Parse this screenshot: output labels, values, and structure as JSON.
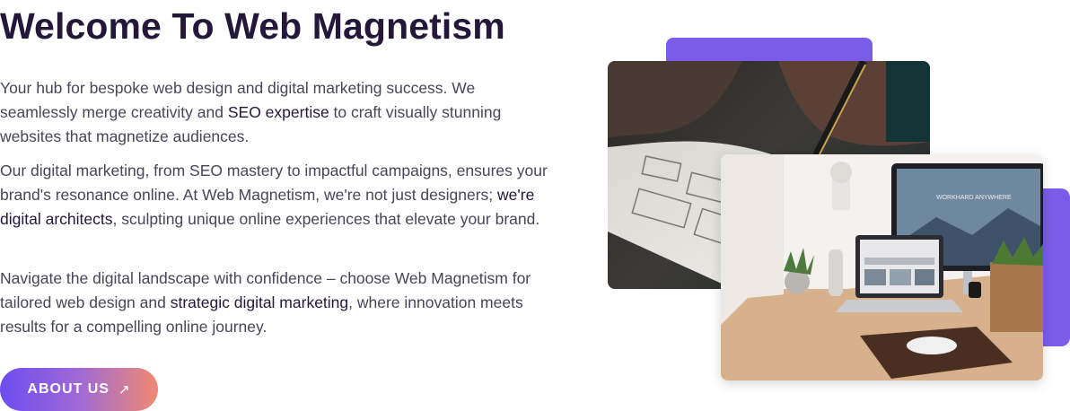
{
  "section": {
    "title": "Welcome To Web Magnetism",
    "paragraph1": {
      "part1": "Your hub for bespoke web design and digital marketing success. We seamlessly merge creativity and ",
      "bold": "SEO expertise",
      "part2": " to craft visually stunning websites that magnetize audiences."
    },
    "paragraph2": {
      "part1": "Our digital marketing, from SEO mastery to impactful campaigns, ensures your brand's resonance online. At Web Magnetism, we're not just designers; ",
      "bold": "we're digital architects",
      "part2": ", sculpting unique online experiences that elevate your brand."
    },
    "paragraph3": {
      "part1": "Navigate the digital landscape with confidence – choose Web Magnetism for tailored web design and ",
      "bold": "strategic digital marketing",
      "part2": ", where innovation meets results for a compelling online journey."
    },
    "about_button": {
      "label": "ABOUT US",
      "icon": "arrow-up-right-icon"
    }
  },
  "colors": {
    "title": "#24173a",
    "body_text": "#4a4458",
    "accent": "#7b5ce9",
    "button_gradient_start": "#6d4cf0",
    "button_gradient_end": "#f08a72"
  },
  "images": {
    "photo1": "hand-sketching-wireframes-photo",
    "photo2": "desk-with-monitor-and-laptop-photo",
    "monitor_screen_text": "WORKHARD ANYWHERE"
  }
}
